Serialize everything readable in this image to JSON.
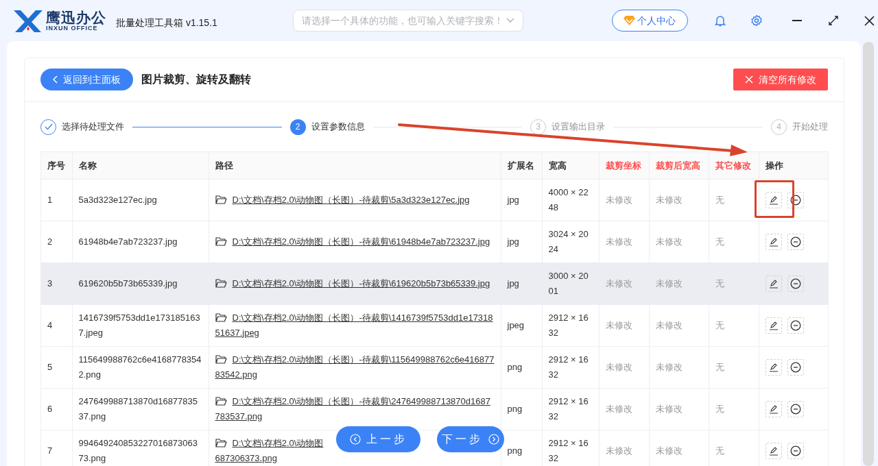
{
  "app": {
    "logo_cn": "鹰迅办公",
    "logo_en": "INXUN OFFICE",
    "title": "批量处理工具箱 v1.15.1"
  },
  "search": {
    "placeholder": "请选择一个具体的功能，也可输入关键字搜索！"
  },
  "user_center": "个人中心",
  "back_button": "返回到主面板",
  "page_title": "图片裁剪、旋转及翻转",
  "clear_button": "清空所有修改",
  "steps": [
    {
      "label": "选择待处理文件",
      "done": true,
      "active": false
    },
    {
      "number": "2",
      "label": "设置参数信息",
      "done": false,
      "active": true
    },
    {
      "number": "3",
      "label": "设置输出目录",
      "done": false,
      "active": false
    },
    {
      "number": "4",
      "label": "开始处理",
      "done": false,
      "active": false
    }
  ],
  "table": {
    "columns": [
      {
        "label": "序号",
        "emphasis": false
      },
      {
        "label": "名称",
        "emphasis": false
      },
      {
        "label": "路径",
        "emphasis": false
      },
      {
        "label": "扩展名",
        "emphasis": false
      },
      {
        "label": "宽高",
        "emphasis": false
      },
      {
        "label": "裁剪坐标",
        "emphasis": true
      },
      {
        "label": "裁剪后宽高",
        "emphasis": true
      },
      {
        "label": "其它修改",
        "emphasis": true
      },
      {
        "label": "操作",
        "emphasis": false
      }
    ],
    "rows": [
      {
        "index": "1",
        "name": "5a3d323e127ec.jpg",
        "path": "D:\\文档\\存档2.0\\动物图（长图）-待裁剪\\5a3d323e127ec.jpg",
        "ext": "jpg",
        "size": "4000 × 2248",
        "crop": "未修改",
        "crop_size": "未修改",
        "other": "无",
        "highlighted": false
      },
      {
        "index": "2",
        "name": "61948b4e7ab723237.jpg",
        "path": "D:\\文档\\存档2.0\\动物图（长图）-待裁剪\\61948b4e7ab723237.jpg",
        "ext": "jpg",
        "size": "3024 × 2024",
        "crop": "未修改",
        "crop_size": "未修改",
        "other": "无",
        "highlighted": false
      },
      {
        "index": "3",
        "name": "619620b5b73b65339.jpg",
        "path": "D:\\文档\\存档2.0\\动物图（长图）-待裁剪\\619620b5b73b65339.jpg",
        "ext": "jpg",
        "size": "3000 × 2001",
        "crop": "未修改",
        "crop_size": "未修改",
        "other": "无",
        "highlighted": true
      },
      {
        "index": "4",
        "name": "1416739f5753dd1e1731851637.jpeg",
        "path": "D:\\文档\\存档2.0\\动物图（长图）-待裁剪\\1416739f5753dd1e1731851637.jpeg",
        "ext": "jpeg",
        "size": "2912 × 1632",
        "crop": "未修改",
        "crop_size": "未修改",
        "other": "无",
        "highlighted": false
      },
      {
        "index": "5",
        "name": "115649988762c6e41687783542.png",
        "path": "D:\\文档\\存档2.0\\动物图（长图）-待裁剪\\115649988762c6e41687783542.png",
        "ext": "png",
        "size": "2912 × 1632",
        "crop": "未修改",
        "crop_size": "未修改",
        "other": "无",
        "highlighted": false
      },
      {
        "index": "6",
        "name": "247649988713870d1687783537.png",
        "path": "D:\\文档\\存档2.0\\动物图（长图）-待裁剪\\247649988713870d1687783537.png",
        "ext": "png",
        "size": "2912 × 1632",
        "crop": "未修改",
        "crop_size": "未修改",
        "other": "无",
        "highlighted": false
      },
      {
        "index": "7",
        "name": "99464924085322701687306373.png",
        "path": "D:\\文档\\存档2.0\\动物图",
        "path_end": "687306373.png",
        "ext": "png",
        "size": "2912 × 1632",
        "crop": "未修改",
        "crop_size": "未修改",
        "other": "无",
        "highlighted": false
      }
    ]
  },
  "prev_button": "上一步",
  "next_button": "下一步"
}
